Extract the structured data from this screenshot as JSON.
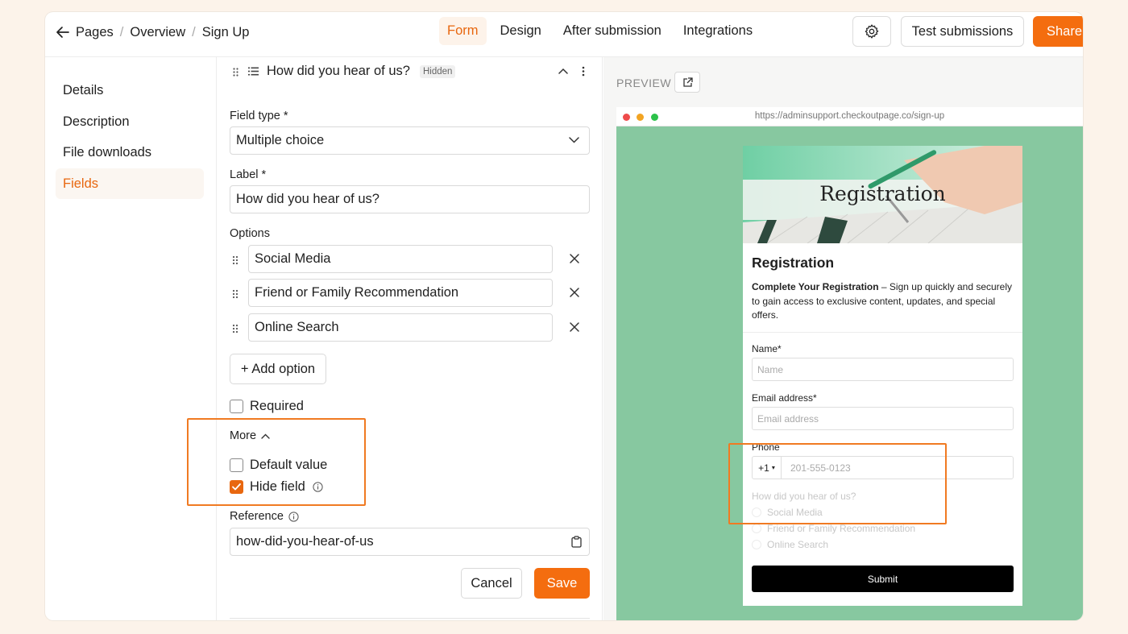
{
  "breadcrumb": {
    "items": [
      "Pages",
      "Overview",
      "Sign Up"
    ]
  },
  "tabs": [
    {
      "label": "Form",
      "active": true
    },
    {
      "label": "Design"
    },
    {
      "label": "After submission"
    },
    {
      "label": "Integrations"
    }
  ],
  "toolbar": {
    "test_label": "Test submissions",
    "share_label": "Share"
  },
  "sidebar": {
    "items": [
      {
        "label": "Details"
      },
      {
        "label": "Description"
      },
      {
        "label": "File downloads"
      },
      {
        "label": "Fields",
        "active": true
      }
    ]
  },
  "editor": {
    "field_title": "How did you hear of us?",
    "hidden_badge": "Hidden",
    "field_type_label": "Field type *",
    "field_type_value": "Multiple choice",
    "label_label": "Label *",
    "label_value": "How did you hear of us?",
    "options_label": "Options",
    "options": [
      "Social Media",
      "Friend or Family Recommendation",
      "Online Search"
    ],
    "add_option_label": "+ Add option",
    "required_label": "Required",
    "required_checked": false,
    "more_label": "More",
    "default_value_label": "Default value",
    "default_value_checked": false,
    "hide_field_label": "Hide field",
    "hide_field_checked": true,
    "reference_label": "Reference",
    "reference_value": "how-did-you-hear-of-us",
    "cancel_label": "Cancel",
    "save_label": "Save"
  },
  "preview": {
    "label": "PREVIEW",
    "url": "https://adminsupport.checkoutpage.co/sign-up",
    "hero_text": "Registration",
    "title": "Registration",
    "desc_bold": "Complete Your Registration",
    "desc_rest": " – Sign up quickly and securely to gain access to exclusive content, updates, and special offers.",
    "name_label": "Name",
    "name_placeholder": "Name",
    "email_label": "Email address",
    "email_placeholder": "Email address",
    "phone_label": "Phone",
    "phone_prefix": "+1",
    "phone_placeholder": "201-555-0123",
    "question": "How did you hear of us?",
    "options": [
      "Social Media",
      "Friend or Family Recommendation",
      "Online Search"
    ],
    "submit_label": "Submit"
  },
  "colors": {
    "accent": "#e8670f",
    "share": "#f46d0f",
    "preview_bg": "#87c8a0",
    "highlight": "#f07a22"
  }
}
